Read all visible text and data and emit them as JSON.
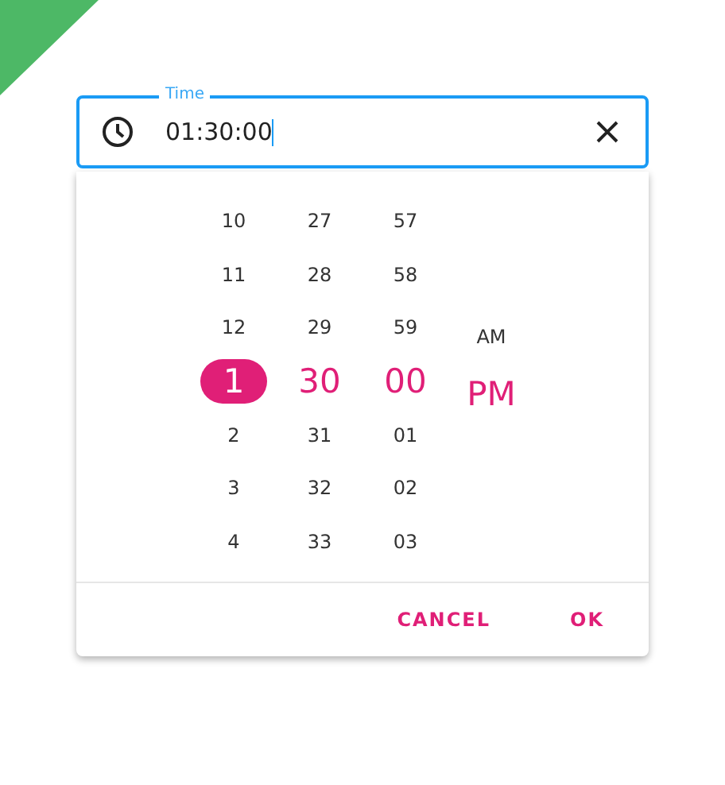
{
  "field": {
    "label": "Time",
    "value": "01:30:00"
  },
  "columns": [
    {
      "focused": true,
      "items": [
        {
          "text": "10",
          "selected": false
        },
        {
          "text": "11",
          "selected": false
        },
        {
          "text": "12",
          "selected": false
        },
        {
          "text": "1",
          "selected": true
        },
        {
          "text": "2",
          "selected": false
        },
        {
          "text": "3",
          "selected": false
        },
        {
          "text": "4",
          "selected": false
        }
      ]
    },
    {
      "focused": false,
      "items": [
        {
          "text": "27",
          "selected": false
        },
        {
          "text": "28",
          "selected": false
        },
        {
          "text": "29",
          "selected": false
        },
        {
          "text": "30",
          "selected": true
        },
        {
          "text": "31",
          "selected": false
        },
        {
          "text": "32",
          "selected": false
        },
        {
          "text": "33",
          "selected": false
        }
      ]
    },
    {
      "focused": false,
      "items": [
        {
          "text": "57",
          "selected": false
        },
        {
          "text": "58",
          "selected": false
        },
        {
          "text": "59",
          "selected": false
        },
        {
          "text": "00",
          "selected": true
        },
        {
          "text": "01",
          "selected": false
        },
        {
          "text": "02",
          "selected": false
        },
        {
          "text": "03",
          "selected": false
        }
      ]
    },
    {
      "focused": false,
      "items": [
        {
          "text": "AM",
          "selected": false
        },
        {
          "text": "PM",
          "selected": true
        }
      ]
    }
  ],
  "buttons": [
    "CANCEL",
    "OK"
  ]
}
